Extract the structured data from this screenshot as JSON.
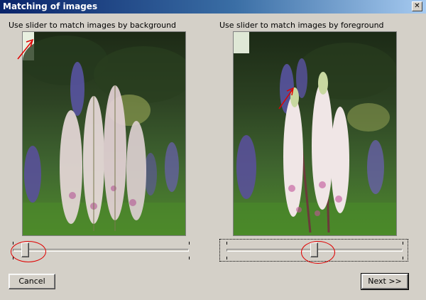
{
  "window": {
    "title": "Matching of images",
    "close_glyph": "✕"
  },
  "left_panel": {
    "label": "Use slider to match images by background",
    "slider_value_fraction": 0.1
  },
  "right_panel": {
    "label": "Use slider to match images by foreground",
    "slider_value_fraction": 0.5
  },
  "buttons": {
    "cancel": "Cancel",
    "next": "Next >>"
  },
  "colors": {
    "annotation": "#e00000",
    "title_gradient_start": "#0a246a",
    "title_gradient_end": "#a6caf0"
  }
}
